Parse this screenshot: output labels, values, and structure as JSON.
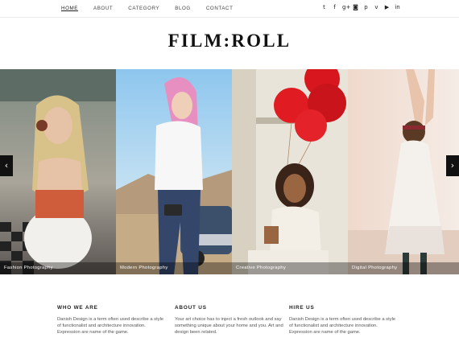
{
  "nav": {
    "items": [
      {
        "label": "HOME",
        "active": true
      },
      {
        "label": "ABOUT",
        "active": false
      },
      {
        "label": "CATEGORY",
        "active": false
      },
      {
        "label": "BLOG",
        "active": false
      },
      {
        "label": "CONTACT",
        "active": false
      }
    ]
  },
  "social": [
    {
      "icon": "twitter-icon",
      "glyph": "t"
    },
    {
      "icon": "facebook-icon",
      "glyph": "f"
    },
    {
      "icon": "google-plus-icon",
      "glyph": "g+"
    },
    {
      "icon": "instagram-icon",
      "glyph": "◙"
    },
    {
      "icon": "pinterest-icon",
      "glyph": "p"
    },
    {
      "icon": "vimeo-icon",
      "glyph": "v"
    },
    {
      "icon": "youtube-icon",
      "glyph": "▶"
    },
    {
      "icon": "linkedin-icon",
      "glyph": "in"
    }
  ],
  "logo": {
    "text": "FILM:ROLL"
  },
  "slider": {
    "slides": [
      {
        "caption": "Fashion Photography"
      },
      {
        "caption": "Modern Photography"
      },
      {
        "caption": "Creative Photography"
      },
      {
        "caption": "Digital Photography"
      }
    ],
    "prev_glyph": "‹",
    "next_glyph": "›"
  },
  "widgets": [
    {
      "title": "WHO WE ARE",
      "text": "Danish Design is a term often used describe a style of functionalist and architecture innovation. Expression are name of the game."
    },
    {
      "title": "ABOUT US",
      "text": "Your art choice has to inject a fresh outlook and say something unique about your home and you. Art and design been related."
    },
    {
      "title": "HIRE US",
      "text": "Danish Design is a term often used describe a style of functionalist and architecture innovation. Expression are name of the game."
    }
  ]
}
